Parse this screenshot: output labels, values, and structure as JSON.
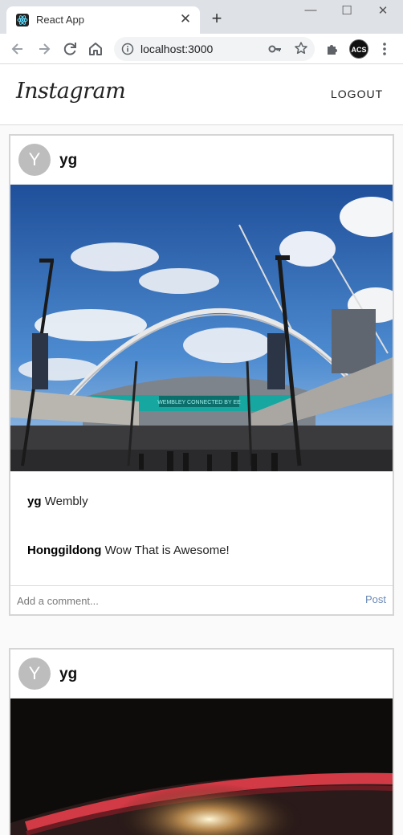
{
  "browser": {
    "tab_title": "React App",
    "url": "localhost:3000",
    "profile_initials": "ACS"
  },
  "app": {
    "logo": "Instagram",
    "logout_label": "LOGOUT"
  },
  "posts": [
    {
      "avatar_letter": "Y",
      "username": "yg",
      "photo_sign": "WEMBLEY CONNECTED BY EE",
      "captions": [
        {
          "user": "yg",
          "text": "Wembly"
        },
        {
          "user": "Honggildong",
          "text": "Wow That is Awesome!"
        }
      ],
      "comment_placeholder": "Add a comment...",
      "post_label": "Post"
    },
    {
      "avatar_letter": "Y",
      "username": "yg"
    }
  ],
  "colors": {
    "post_link": "#6a8ab6",
    "avatar_bg": "#bdbdbd"
  }
}
